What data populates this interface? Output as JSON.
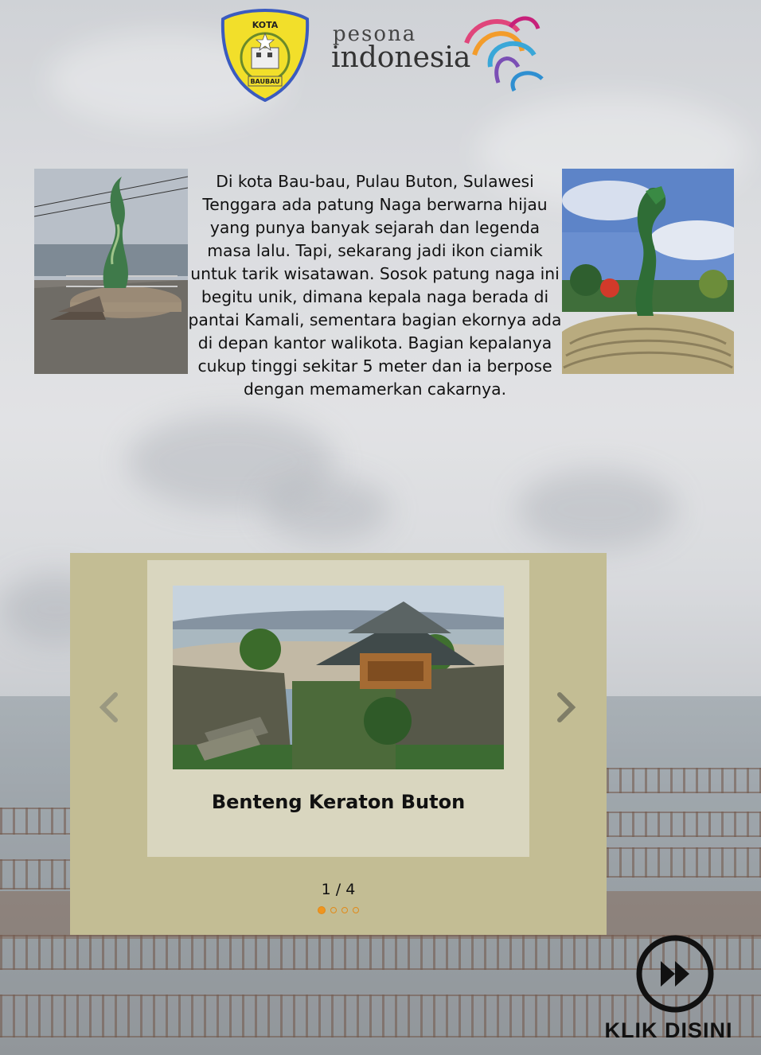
{
  "header": {
    "kota_logo_top_text": "KOTA",
    "kota_logo_bottom_text": "BAUBAU",
    "pesona_text": "pesona",
    "indonesia_text": "indonesia"
  },
  "intro": {
    "text": "Di kota Bau-bau, Pulau Buton, Sulawesi Tenggara ada patung Naga berwarna hijau yang punya banyak sejarah dan legenda masa lalu. Tapi, sekarang jadi ikon ciamik untuk tarik wisatawan. Sosok patung naga ini begitu unik, dimana kepala naga berada di pantai Kamali, sementara bagian ekornya ada di depan kantor walikota. Bagian kepalanya cukup tinggi sekitar 5 meter dan ia berpose dengan memamerkan cakarnya."
  },
  "slider": {
    "caption": "Benteng Keraton Buton",
    "counter": "1 / 4",
    "prev_icon": "chevron-left-icon",
    "next_icon": "chevron-right-icon",
    "dots": 4,
    "active_dot": 1,
    "accent_color": "#f0951e"
  },
  "cta": {
    "label": "KLIK DISINI",
    "icon": "fast-forward-circle-icon"
  }
}
